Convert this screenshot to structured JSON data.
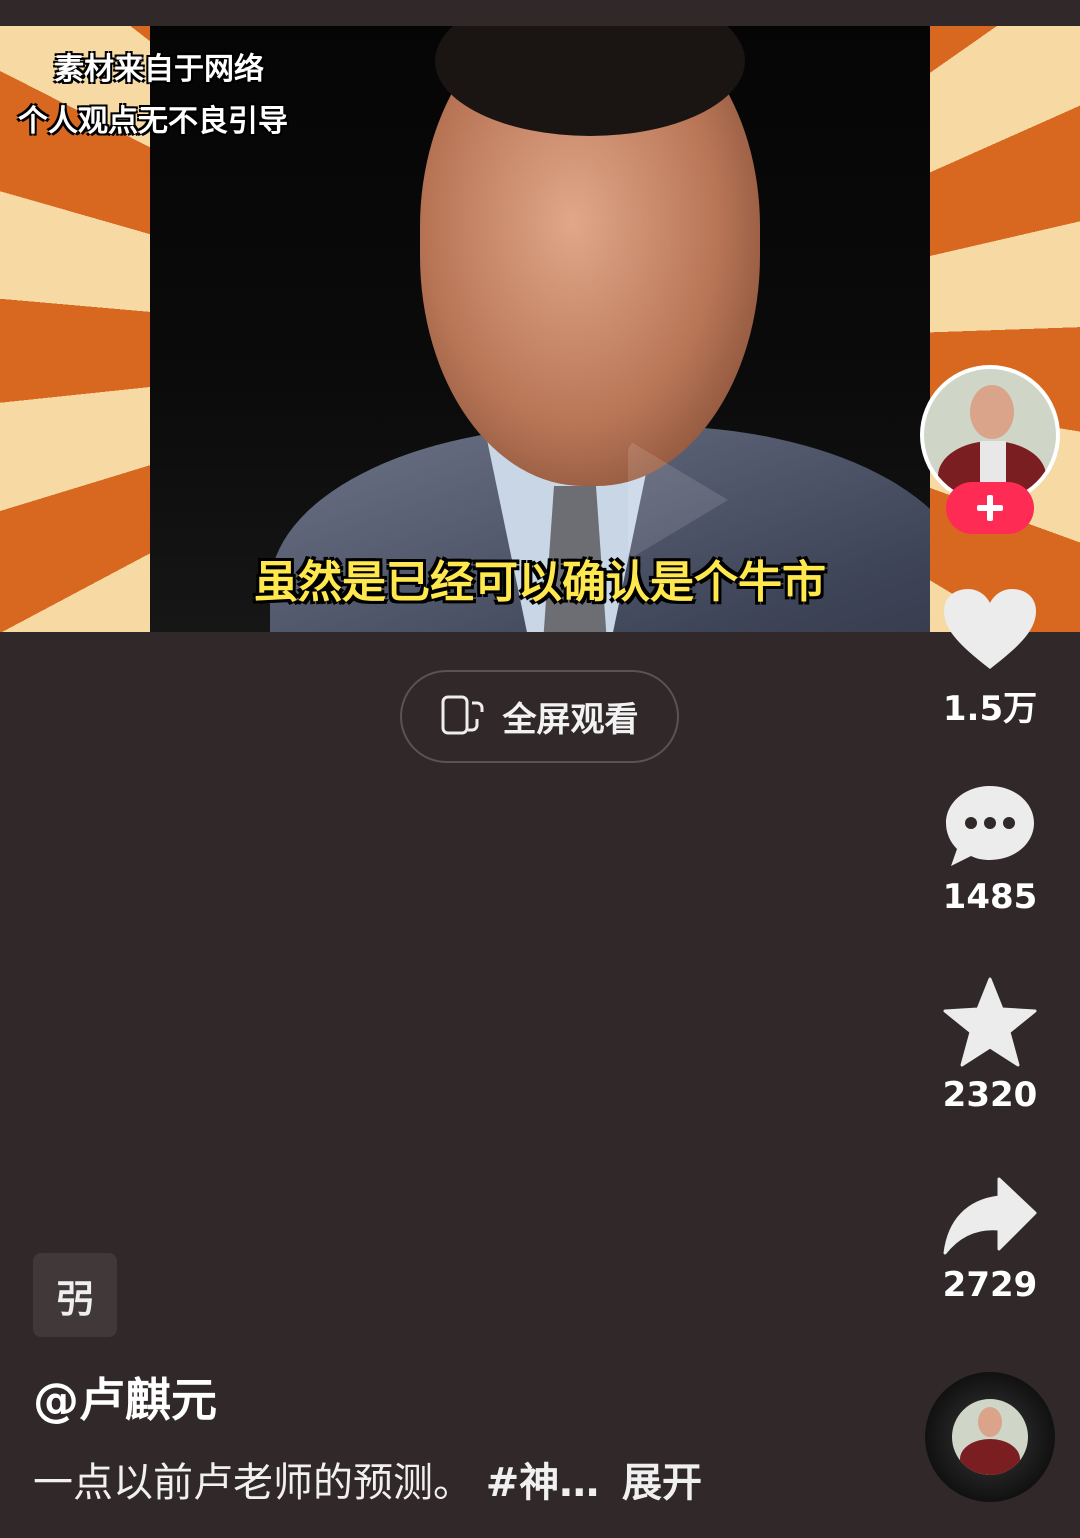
{
  "video": {
    "watermark_line1": "素材来自于网络",
    "watermark_line2": "个人观点无不良引导",
    "subtitle": "虽然是已经可以确认是个牛市"
  },
  "fullscreen_button": {
    "label": "全屏观看",
    "icon": "rotate-screen-icon"
  },
  "actions": {
    "likes": "1.5万",
    "comments": "1485",
    "favorites": "2320",
    "shares": "2729"
  },
  "info": {
    "tag": "弜",
    "author": "@卢麒元",
    "caption": "一点以前卢老师的预测。",
    "hashtag": "#神…",
    "expand": "展开"
  },
  "colors": {
    "background": "#302829",
    "follow": "#fe2c55",
    "subtitle": "#ffe84d"
  }
}
